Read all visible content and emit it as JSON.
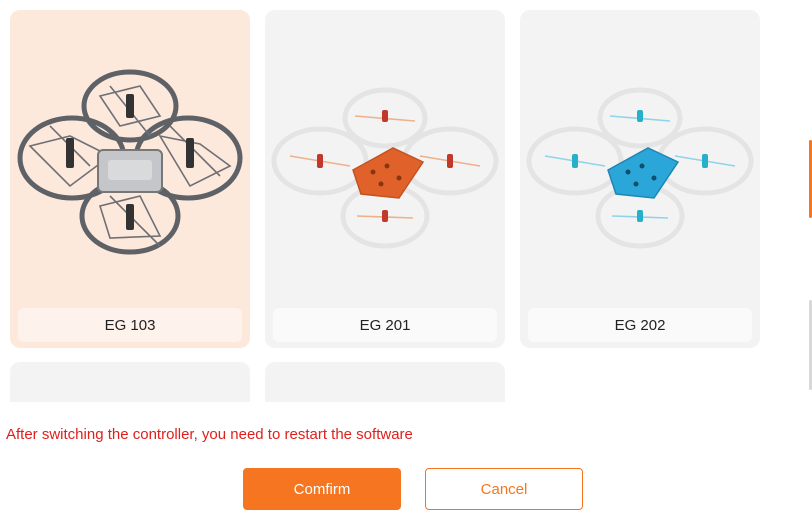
{
  "controllers": [
    {
      "label": "EG 103",
      "selected": true,
      "body_color": "#8a8d92"
    },
    {
      "label": "EG 201",
      "selected": false,
      "body_color": "#e0622a"
    },
    {
      "label": "EG 202",
      "selected": false,
      "body_color": "#2aa6d9"
    }
  ],
  "warning_text": "After switching the controller, you need to restart the software",
  "buttons": {
    "confirm_label": "Comfirm",
    "cancel_label": "Cancel"
  },
  "colors": {
    "accent": "#f57520",
    "warning": "#e0201c",
    "selected_card": "#fde8dc"
  }
}
